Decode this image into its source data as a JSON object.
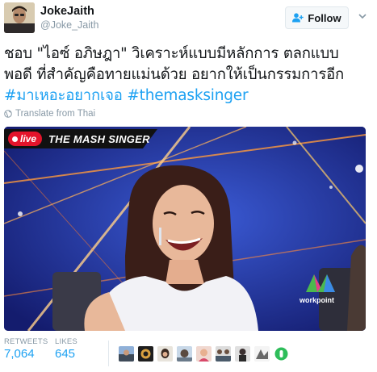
{
  "author": {
    "display_name": "JokeJaith",
    "handle": "@Joke_Jaith"
  },
  "follow_label": "Follow",
  "tweet": {
    "text_part": "ชอบ \"ไอซ์ อภิษฎา\" วิเคราะห์แบบมีหลักการ ตลกแบบพอดี ที่สำคัญคือทายแม่นด้วย อยากให้เป็นกรรมการอีก ",
    "hashtag1": "#มาเหอะอยากเจอ",
    "hashtag2": "#themasksinger"
  },
  "translate_label": "Translate from Thai",
  "media": {
    "live_label": "live",
    "show_title": "THE MASH SINGER",
    "logo_text": "workpoint"
  },
  "stats": {
    "retweets_label": "RETWEETS",
    "retweets_value": "7,064",
    "likes_label": "LIKES",
    "likes_value": "645"
  },
  "liker_avatars": [
    "liker-avatar-1",
    "liker-avatar-2",
    "liker-avatar-3",
    "liker-avatar-4",
    "liker-avatar-5",
    "liker-avatar-6",
    "liker-avatar-7",
    "liker-avatar-8",
    "liker-avatar-9"
  ],
  "colors": {
    "accent": "#1da1f2",
    "muted": "#8899a6",
    "live_red": "#e4142b"
  }
}
